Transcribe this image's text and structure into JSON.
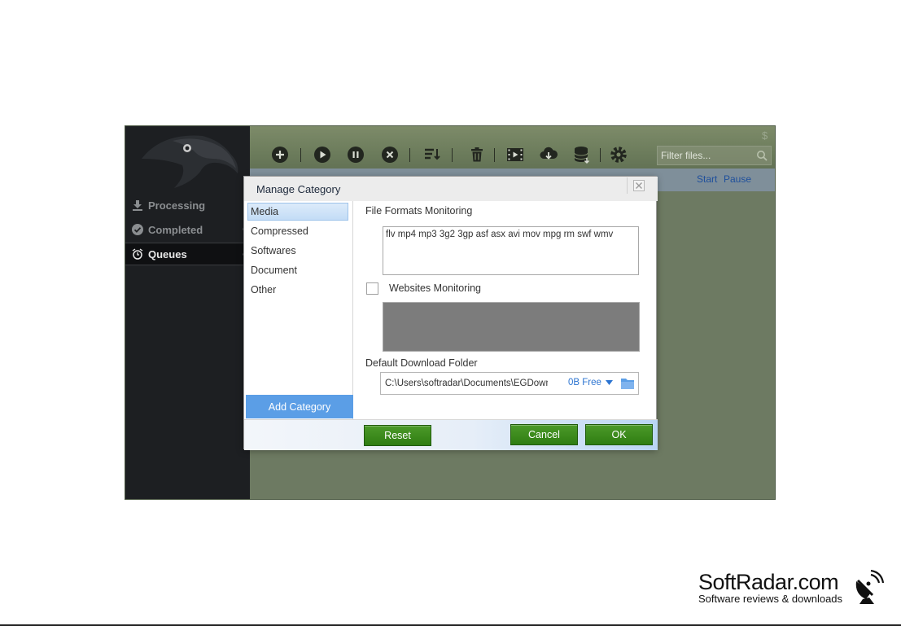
{
  "sidebar": {
    "items": [
      {
        "label": "Processing",
        "icon": "download-icon"
      },
      {
        "label": "Completed",
        "icon": "check-circle-icon"
      },
      {
        "label": "Queues",
        "icon": "alarm-clock-icon"
      }
    ]
  },
  "toolbar": {
    "buttons": [
      "add-icon",
      "play-icon",
      "pause-icon",
      "stop-icon",
      "sort-icon",
      "trash-icon",
      "video-icon",
      "cloud-download-icon",
      "database-icon",
      "gear-icon"
    ],
    "filter_placeholder": "Filter files..."
  },
  "columns": {
    "start_label": "Start",
    "pause_label": "Pause"
  },
  "dialog": {
    "title": "Manage Category",
    "categories": [
      "Media",
      "Compressed",
      "Softwares",
      "Document",
      "Other"
    ],
    "selected_category": "Media",
    "add_category_label": "Add Category",
    "file_formats_label": "File Formats Monitoring",
    "file_formats_value": "flv mp4 mp3 3g2 3gp asf asx avi mov mpg rm swf wmv",
    "websites_label": "Websites Monitoring",
    "websites_checked": false,
    "folder_label": "Default Download Folder",
    "folder_path": "C:\\Users\\softradar\\Documents\\EGDownloads",
    "free_space": "0B Free",
    "reset_label": "Reset",
    "cancel_label": "Cancel",
    "ok_label": "OK"
  },
  "watermark": {
    "title": "SoftRadar.com",
    "subtitle": "Software reviews & downloads"
  },
  "colors": {
    "accent_blue": "#5b9ee6",
    "button_green": "#2f7d12",
    "sidebar_dark": "#1d1f22"
  }
}
